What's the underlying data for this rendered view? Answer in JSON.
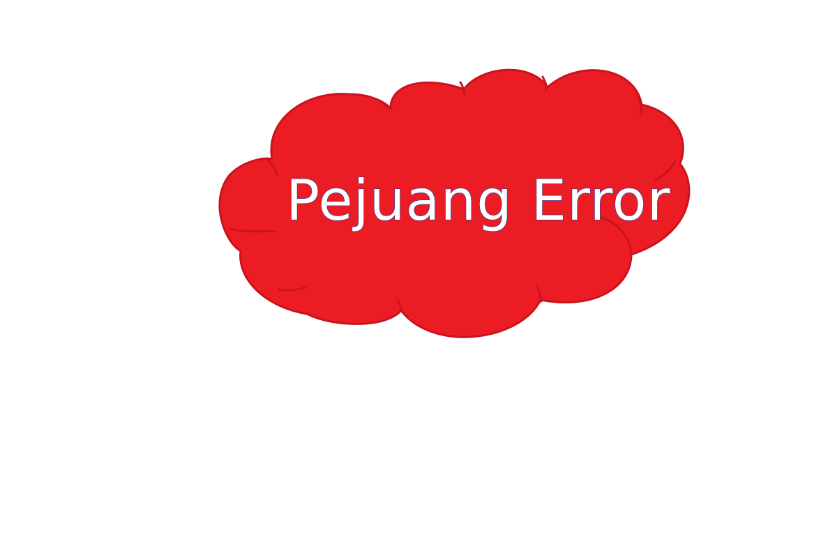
{
  "logo": {
    "text": "Pejuang Error",
    "shape": "cloud",
    "colors": {
      "background": "#ffffff",
      "cloud_fill": "#ec1c24",
      "cloud_outline": "#c8141c",
      "text_fill": "#ffffff",
      "text_outline": "#1f3aa0"
    }
  }
}
